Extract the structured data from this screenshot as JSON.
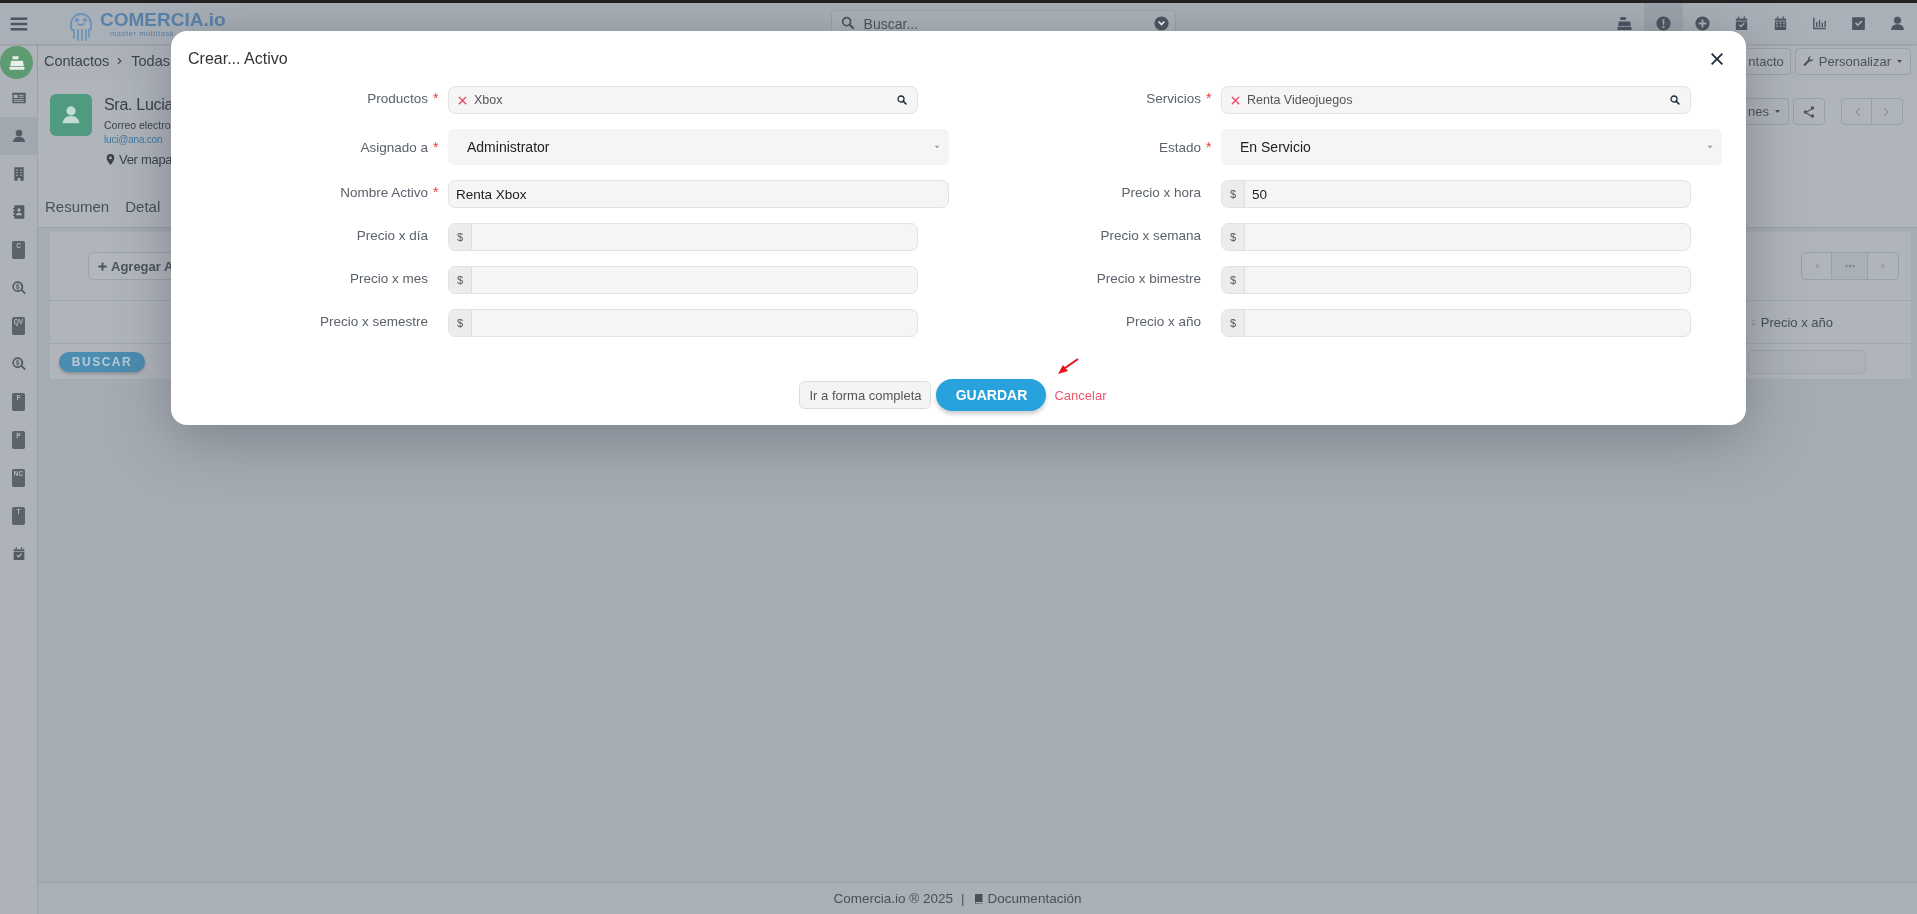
{
  "topbar": {
    "logo": {
      "name": "COMERCIA.io",
      "tagline": "master multitask"
    },
    "search": {
      "placeholder": "Buscar..."
    },
    "icons": [
      {
        "kind": "register",
        "selected": false
      },
      {
        "kind": "alert",
        "selected": true
      },
      {
        "kind": "plus",
        "selected": false
      },
      {
        "kind": "calendar-check",
        "selected": false
      },
      {
        "kind": "calendar",
        "selected": false
      },
      {
        "kind": "chart",
        "selected": false
      },
      {
        "kind": "check-square",
        "selected": false
      },
      {
        "kind": "user",
        "selected": false
      }
    ]
  },
  "sidebar": {
    "items": [
      {
        "kind": "id-card",
        "selected": false
      },
      {
        "kind": "user",
        "selected": true
      },
      {
        "kind": "building",
        "selected": false
      },
      {
        "kind": "contacts",
        "selected": false
      },
      {
        "kind": "document",
        "letter": "C",
        "selected": false
      },
      {
        "kind": "search-dollar",
        "selected": false
      },
      {
        "kind": "document",
        "letter": "QV",
        "selected": false
      },
      {
        "kind": "search-dollar",
        "selected": false
      },
      {
        "kind": "document",
        "letter": "F",
        "selected": false
      },
      {
        "kind": "document",
        "letter": "P",
        "selected": false
      },
      {
        "kind": "document",
        "letter": "NC",
        "selected": false
      },
      {
        "kind": "document",
        "letter": "T",
        "selected": false
      },
      {
        "kind": "calendar-check",
        "selected": false
      }
    ]
  },
  "breadcrumb": [
    "Contactos",
    "Todas"
  ],
  "header_buttons": {
    "contact": "ntacto",
    "customize": "Personalizar",
    "options": "nes"
  },
  "contact": {
    "name": "Sra. Lucia",
    "email_label": "Correo electro",
    "email": "luci@ana.con",
    "map_link": "Ver mapa"
  },
  "tabs": [
    "Resumen",
    "Detal"
  ],
  "panel": {
    "add_button": "Agregar A",
    "search_button": "BUSCAR",
    "column": "Precio x año"
  },
  "modal": {
    "title": "Crear... Activo",
    "fields": [
      {
        "kind": "lookup",
        "label": "Productos",
        "required_mark": "*",
        "value": "Xbox"
      },
      {
        "kind": "lookup",
        "label": "Servicios",
        "required_mark": "*",
        "value": "Renta Videojuegos"
      },
      {
        "kind": "select",
        "label": "Asignado a",
        "required_mark": "*",
        "value": "Administrator"
      },
      {
        "kind": "select",
        "label": "Estado",
        "required_mark": "*",
        "value": "En Servicio"
      },
      {
        "kind": "text",
        "label": "Nombre Activo",
        "required_mark": "*",
        "value": "Renta Xbox"
      },
      {
        "kind": "currency",
        "label": "Precio x hora",
        "prefix": "$",
        "value": "50"
      },
      {
        "kind": "currency",
        "label": "Precio x día",
        "prefix": "$"
      },
      {
        "kind": "currency",
        "label": "Precio x semana",
        "prefix": "$"
      },
      {
        "kind": "currency",
        "label": "Precio x mes",
        "prefix": "$"
      },
      {
        "kind": "currency",
        "label": "Precio x bimestre",
        "prefix": "$"
      },
      {
        "kind": "currency",
        "label": "Precio x semestre",
        "prefix": "$"
      },
      {
        "kind": "currency",
        "label": "Precio x año",
        "prefix": "$"
      }
    ],
    "buttons": {
      "full_form": "Ir a forma completa",
      "save": "GUARDAR",
      "cancel": "Cancelar"
    }
  },
  "footer": {
    "copyright": "Comercia.io ® 2025",
    "separator": "|",
    "docs_link": "Documentación"
  }
}
